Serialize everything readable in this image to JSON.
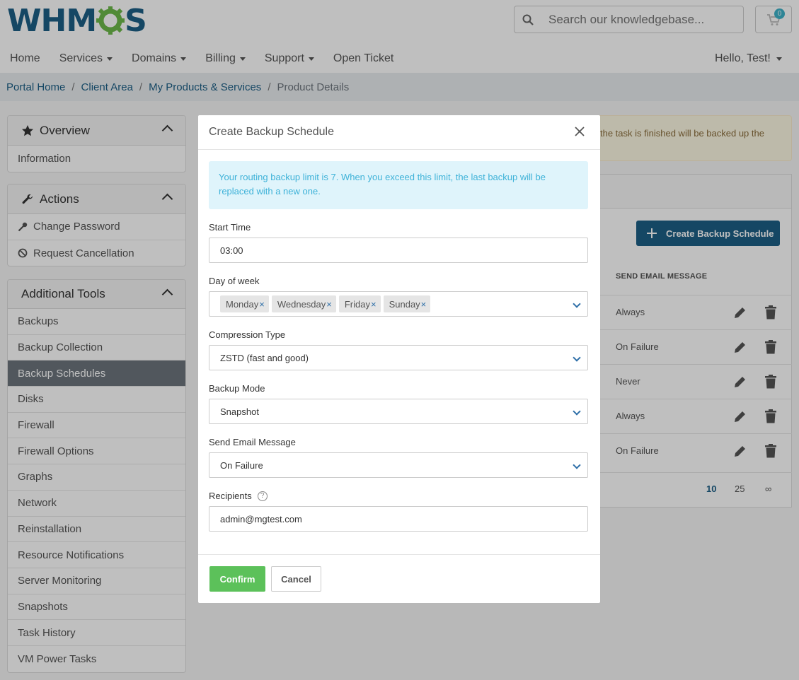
{
  "header": {
    "logo_text": "WHMCS",
    "search_placeholder": "Search our knowledgebase...",
    "cart_count": "0"
  },
  "nav": {
    "items": [
      {
        "label": "Home",
        "dropdown": false
      },
      {
        "label": "Services",
        "dropdown": true
      },
      {
        "label": "Domains",
        "dropdown": true
      },
      {
        "label": "Billing",
        "dropdown": true
      },
      {
        "label": "Support",
        "dropdown": true
      },
      {
        "label": "Open Ticket",
        "dropdown": false
      }
    ],
    "account": "Hello, Test!"
  },
  "breadcrumb": [
    "Portal Home",
    "Client Area",
    "My Products & Services",
    "Product Details"
  ],
  "sidebar": {
    "overview": {
      "title": "Overview",
      "items": [
        "Information"
      ]
    },
    "actions": {
      "title": "Actions",
      "items": [
        "Change Password",
        "Request Cancellation"
      ]
    },
    "tools": {
      "title": "Additional Tools",
      "items": [
        "Backups",
        "Backup Collection",
        "Backup Schedules",
        "Disks",
        "Firewall",
        "Firewall Options",
        "Graphs",
        "Network",
        "Reinstallation",
        "Resource Notifications",
        "Server Monitoring",
        "Snapshots",
        "Task History",
        "VM Power Tasks"
      ],
      "active": "Backup Schedules"
    }
  },
  "background": {
    "alert_fragment": "the task is finished will be backed up the",
    "create_button": "Create Backup Schedule",
    "column_header": "SEND EMAIL MESSAGE",
    "rows": [
      "Always",
      "On Failure",
      "Never",
      "Always",
      "On Failure"
    ],
    "pager": [
      "10",
      "25",
      "∞"
    ]
  },
  "modal": {
    "title": "Create Backup Schedule",
    "info": "Your routing backup limit is 7. When you exceed this limit, the last backup will be replaced with a new one.",
    "start_time": {
      "label": "Start Time",
      "value": "03:00"
    },
    "day_of_week": {
      "label": "Day of week",
      "values": [
        "Monday",
        "Wednesday",
        "Friday",
        "Sunday"
      ]
    },
    "compression": {
      "label": "Compression Type",
      "value": "ZSTD (fast and good)"
    },
    "backup_mode": {
      "label": "Backup Mode",
      "value": "Snapshot"
    },
    "send_email": {
      "label": "Send Email Message",
      "value": "On Failure"
    },
    "recipients": {
      "label": "Recipients",
      "value": "admin@mgtest.com"
    },
    "confirm": "Confirm",
    "cancel": "Cancel"
  },
  "colors": {
    "brand": "#1c5f86",
    "confirm": "#5cc15a",
    "info_bg": "#dff4fb",
    "info_text": "#3eb2d8",
    "active_sidebar": "#6c757d"
  }
}
